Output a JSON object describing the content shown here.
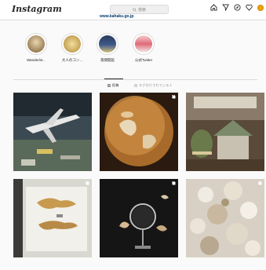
{
  "header": {
    "logo": "Instagram",
    "search_placeholder": "検索",
    "icons": [
      "home-icon",
      "direct-icon",
      "explore-icon",
      "heart-icon",
      "profile-avatar"
    ]
  },
  "profile": {
    "website": "www.kahaku.go.jp"
  },
  "highlights": [
    {
      "label": "Wanderlst...",
      "color": "#8a6a3a"
    },
    {
      "label": "大人のコン...",
      "color": "#c8a04a"
    },
    {
      "label": "夜間開館",
      "color": "#3a4a6a"
    },
    {
      "label": "公式Twitter",
      "color": "#d06070"
    }
  ],
  "tabs": [
    {
      "label": "投稿",
      "icon": "grid-icon",
      "active": true
    },
    {
      "label": "タグ付けされている人",
      "icon": "tag-icon",
      "active": false
    }
  ],
  "posts": [
    {
      "name": "airplane-hall",
      "multi": false
    },
    {
      "name": "globe-sphere",
      "multi": true
    },
    {
      "name": "house-diorama",
      "multi": false
    },
    {
      "name": "coral-specimen",
      "multi": true
    },
    {
      "name": "magnifier-display",
      "multi": true
    },
    {
      "name": "shells-collection",
      "multi": true
    }
  ]
}
